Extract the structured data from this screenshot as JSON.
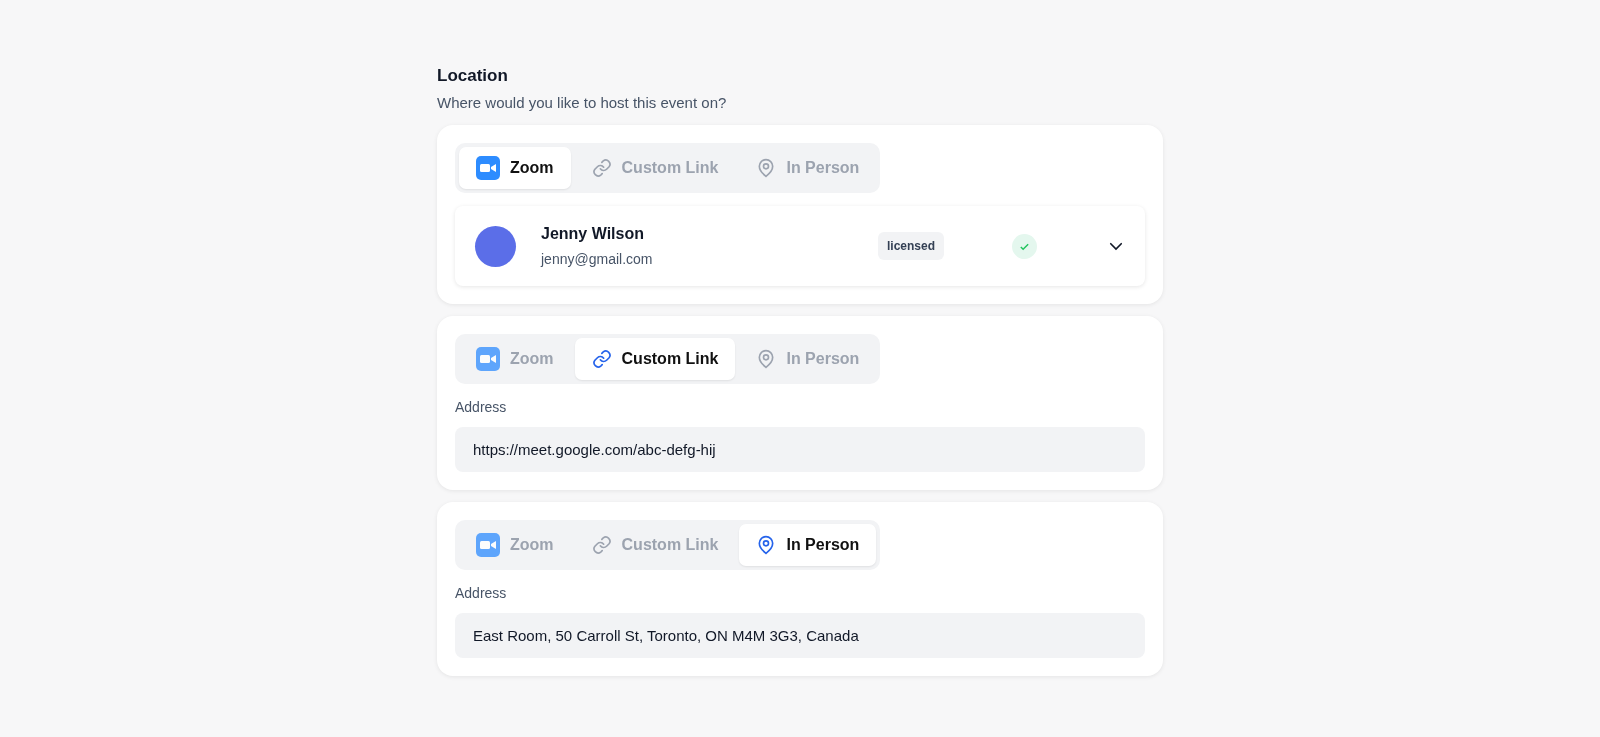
{
  "section": {
    "title": "Location",
    "subtitle": "Where would you like to host this event on?"
  },
  "cards": [
    {
      "kind": "account",
      "tabs": [
        {
          "kind": "zoom",
          "label": "Zoom",
          "selected": true
        },
        {
          "kind": "link",
          "label": "Custom Link",
          "selected": false
        },
        {
          "kind": "person",
          "label": "In Person",
          "selected": false
        }
      ],
      "account": {
        "name": "Jenny Wilson",
        "email": "jenny@gmail.com",
        "badge": "licensed",
        "verified": true
      }
    },
    {
      "kind": "address",
      "tabs": [
        {
          "kind": "zoom",
          "label": "Zoom",
          "selected": false
        },
        {
          "kind": "link",
          "label": "Custom Link",
          "selected": true
        },
        {
          "kind": "person",
          "label": "In Person",
          "selected": false
        }
      ],
      "field": {
        "label": "Address",
        "value": "https://meet.google.com/abc-defg-hij"
      }
    },
    {
      "kind": "address",
      "tabs": [
        {
          "kind": "zoom",
          "label": "Zoom",
          "selected": false
        },
        {
          "kind": "link",
          "label": "Custom Link",
          "selected": false
        },
        {
          "kind": "person",
          "label": "In Person",
          "selected": true
        }
      ],
      "field": {
        "label": "Address",
        "value": "East Room, 50 Carroll St, Toronto, ON M4M 3G3, Canada"
      }
    }
  ]
}
